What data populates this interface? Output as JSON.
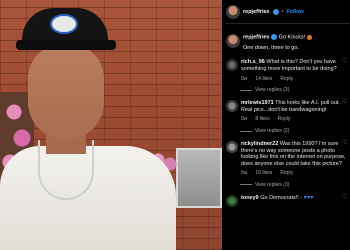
{
  "post": {
    "username": "repjeffries",
    "follow_label": "Follow",
    "caption_text": "Go Knicks!",
    "caption_line2": "One down, three to go."
  },
  "comments": [
    {
      "username": "rich.s_96",
      "text": "What is this? Don't you have something more important to be doing?",
      "age": "5w",
      "likes": "14 likes",
      "reply_label": "Reply",
      "view_replies": "View replies (3)"
    },
    {
      "username": "mrlewis1971",
      "text": "This looks like A.I. pull out. Real pics...don't be bandwagoning!",
      "age": "5w",
      "likes": "8 likes",
      "reply_label": "Reply",
      "view_replies": "View replies (2)"
    },
    {
      "username": "rickylindner22",
      "text": "Was this 1990? I'm sure there's no way someone posts a photo looking like this on the internet on purpose, does anyone else could take this picture?",
      "age": "5w",
      "likes": "16 likes",
      "reply_label": "Reply",
      "view_replies": "View replies (3)"
    },
    {
      "username": "toney9",
      "text": "Go Democrats!! -",
      "age": "",
      "likes": "",
      "reply_label": "",
      "view_replies": ""
    }
  ],
  "colors": {
    "accent": "#0095f6",
    "verified": "#3897f0",
    "muted": "#a8a8a8",
    "background": "#000000"
  },
  "icons": {
    "verified": "verified-badge-icon",
    "like": "heart-icon"
  }
}
